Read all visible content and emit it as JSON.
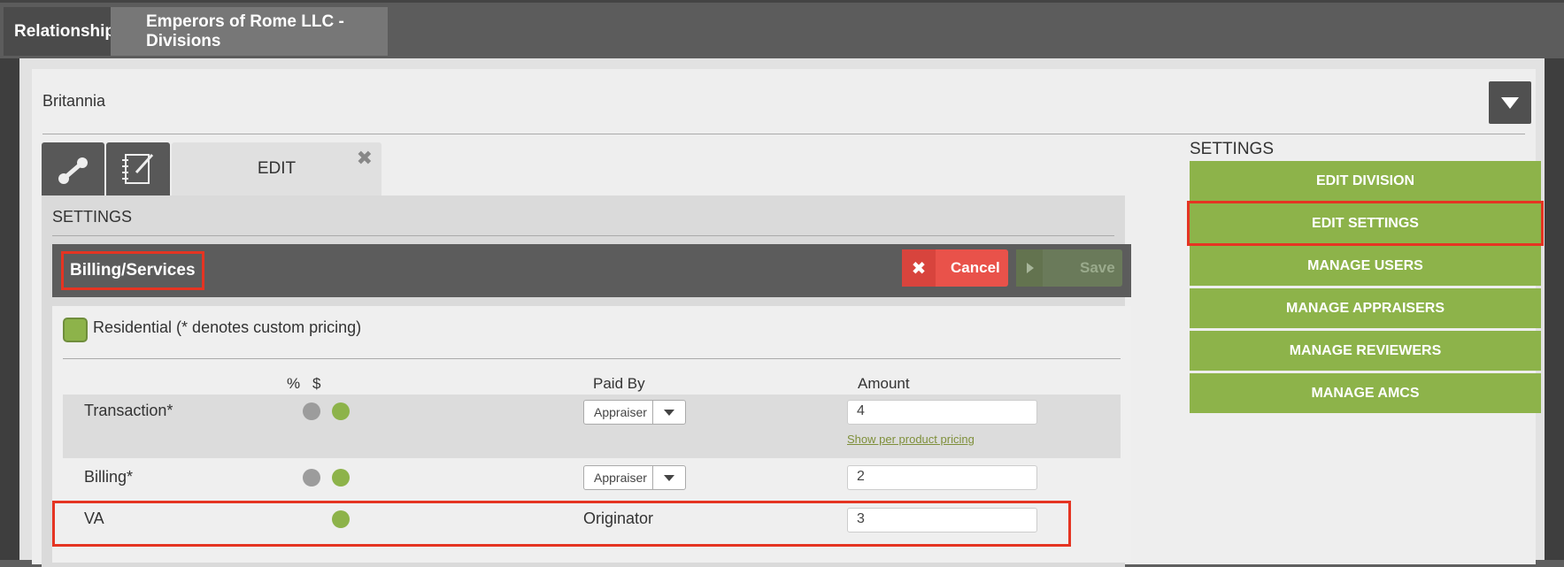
{
  "breadcrumb": {
    "root": "Relationships",
    "current": "Emperors of Rome LLC - Divisions"
  },
  "panel": {
    "title": "Britannia"
  },
  "tabs": {
    "edit_label": "EDIT",
    "close_glyph": "✖"
  },
  "settings_heading": "SETTINGS",
  "billing": {
    "title": "Billing/Services",
    "cancel_label": "Cancel",
    "save_label": "Save",
    "residential_label": "Residential (* denotes custom pricing)",
    "columns": {
      "percent": "%",
      "dollar": "$",
      "paid_by": "Paid By",
      "amount": "Amount"
    },
    "rows": [
      {
        "label": "Transaction*",
        "paid_by": "Appraiser",
        "amount": "4",
        "link": "Show per product pricing"
      },
      {
        "label": "Billing*",
        "paid_by": "Appraiser",
        "amount": "2"
      },
      {
        "label": "VA",
        "paid_by": "Originator",
        "amount": "3"
      }
    ]
  },
  "side_menu": {
    "title": "SETTINGS",
    "items": [
      {
        "label": "EDIT DIVISION"
      },
      {
        "label": "EDIT SETTINGS"
      },
      {
        "label": "MANAGE USERS"
      },
      {
        "label": "MANAGE APPRAISERS"
      },
      {
        "label": "MANAGE REVIEWERS"
      },
      {
        "label": "MANAGE AMCS"
      }
    ]
  },
  "colors": {
    "accent_green": "#8db34a",
    "cancel_red": "#e9524a",
    "highlight_red": "#e53422"
  },
  "icons": [
    "link-icon",
    "notebook-edit-icon",
    "close-icon",
    "chevron-down-icon",
    "x-icon",
    "play-icon"
  ]
}
